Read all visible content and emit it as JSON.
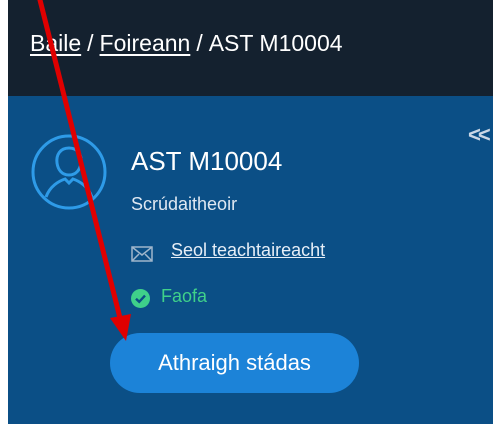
{
  "breadcrumb": {
    "items": [
      "Baile",
      "Foireann",
      "AST M10004"
    ],
    "separator": "/"
  },
  "profile": {
    "name": "AST M10004",
    "role": "Scrúdaitheoir",
    "send_message_label": "Seol teachtaireacht",
    "status": "Faofa",
    "change_status_label": "Athraigh stádas"
  },
  "collapse_label": "<<",
  "icons": {
    "avatar": "user-avatar-icon",
    "mail": "envelope-icon",
    "status": "check-circle-icon",
    "collapse": "double-chevron-left-icon",
    "annotation": "red-arrow"
  },
  "colors": {
    "header_bg": "#14212f",
    "panel_bg": "#0b4f86",
    "button_bg": "#1c83d8",
    "status_green": "#3fd08a",
    "arrow_red": "#e00000"
  }
}
